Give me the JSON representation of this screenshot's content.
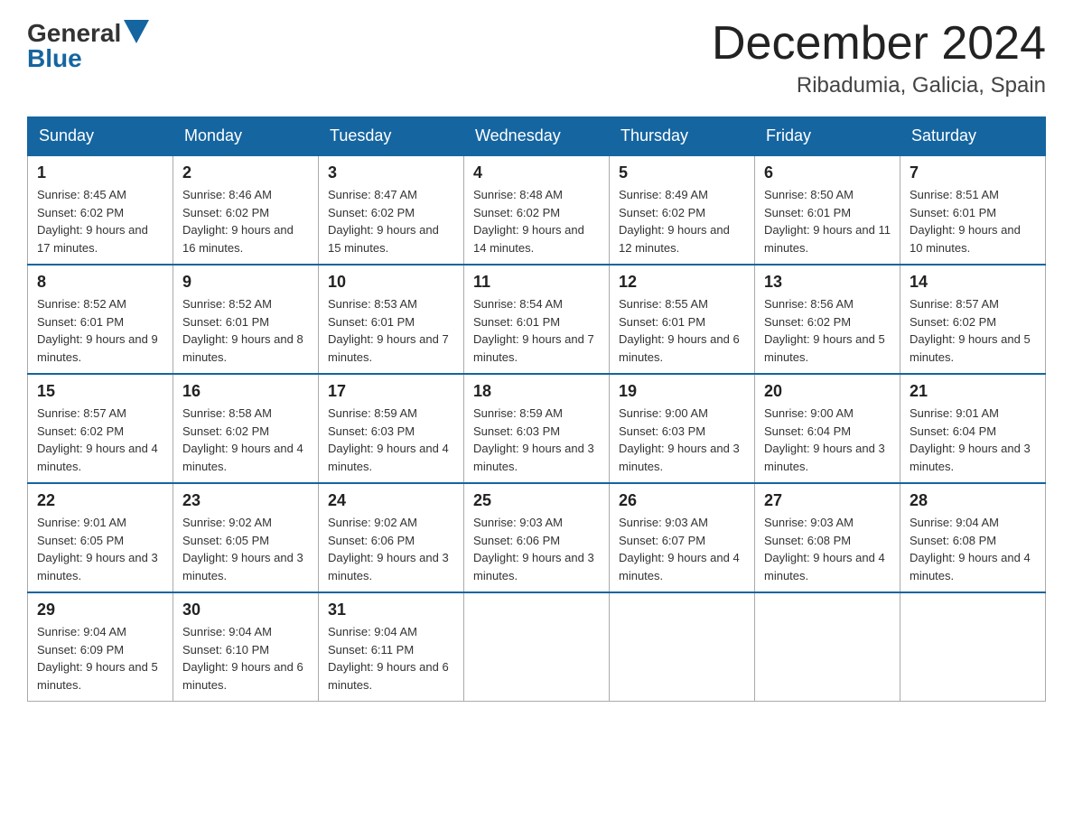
{
  "logo": {
    "text_general": "General",
    "text_blue": "Blue"
  },
  "header": {
    "month_year": "December 2024",
    "location": "Ribadumia, Galicia, Spain"
  },
  "weekdays": [
    "Sunday",
    "Monday",
    "Tuesday",
    "Wednesday",
    "Thursday",
    "Friday",
    "Saturday"
  ],
  "weeks": [
    [
      {
        "day": "1",
        "sunrise": "8:45 AM",
        "sunset": "6:02 PM",
        "daylight": "9 hours and 17 minutes."
      },
      {
        "day": "2",
        "sunrise": "8:46 AM",
        "sunset": "6:02 PM",
        "daylight": "9 hours and 16 minutes."
      },
      {
        "day": "3",
        "sunrise": "8:47 AM",
        "sunset": "6:02 PM",
        "daylight": "9 hours and 15 minutes."
      },
      {
        "day": "4",
        "sunrise": "8:48 AM",
        "sunset": "6:02 PM",
        "daylight": "9 hours and 14 minutes."
      },
      {
        "day": "5",
        "sunrise": "8:49 AM",
        "sunset": "6:02 PM",
        "daylight": "9 hours and 12 minutes."
      },
      {
        "day": "6",
        "sunrise": "8:50 AM",
        "sunset": "6:01 PM",
        "daylight": "9 hours and 11 minutes."
      },
      {
        "day": "7",
        "sunrise": "8:51 AM",
        "sunset": "6:01 PM",
        "daylight": "9 hours and 10 minutes."
      }
    ],
    [
      {
        "day": "8",
        "sunrise": "8:52 AM",
        "sunset": "6:01 PM",
        "daylight": "9 hours and 9 minutes."
      },
      {
        "day": "9",
        "sunrise": "8:52 AM",
        "sunset": "6:01 PM",
        "daylight": "9 hours and 8 minutes."
      },
      {
        "day": "10",
        "sunrise": "8:53 AM",
        "sunset": "6:01 PM",
        "daylight": "9 hours and 7 minutes."
      },
      {
        "day": "11",
        "sunrise": "8:54 AM",
        "sunset": "6:01 PM",
        "daylight": "9 hours and 7 minutes."
      },
      {
        "day": "12",
        "sunrise": "8:55 AM",
        "sunset": "6:01 PM",
        "daylight": "9 hours and 6 minutes."
      },
      {
        "day": "13",
        "sunrise": "8:56 AM",
        "sunset": "6:02 PM",
        "daylight": "9 hours and 5 minutes."
      },
      {
        "day": "14",
        "sunrise": "8:57 AM",
        "sunset": "6:02 PM",
        "daylight": "9 hours and 5 minutes."
      }
    ],
    [
      {
        "day": "15",
        "sunrise": "8:57 AM",
        "sunset": "6:02 PM",
        "daylight": "9 hours and 4 minutes."
      },
      {
        "day": "16",
        "sunrise": "8:58 AM",
        "sunset": "6:02 PM",
        "daylight": "9 hours and 4 minutes."
      },
      {
        "day": "17",
        "sunrise": "8:59 AM",
        "sunset": "6:03 PM",
        "daylight": "9 hours and 4 minutes."
      },
      {
        "day": "18",
        "sunrise": "8:59 AM",
        "sunset": "6:03 PM",
        "daylight": "9 hours and 3 minutes."
      },
      {
        "day": "19",
        "sunrise": "9:00 AM",
        "sunset": "6:03 PM",
        "daylight": "9 hours and 3 minutes."
      },
      {
        "day": "20",
        "sunrise": "9:00 AM",
        "sunset": "6:04 PM",
        "daylight": "9 hours and 3 minutes."
      },
      {
        "day": "21",
        "sunrise": "9:01 AM",
        "sunset": "6:04 PM",
        "daylight": "9 hours and 3 minutes."
      }
    ],
    [
      {
        "day": "22",
        "sunrise": "9:01 AM",
        "sunset": "6:05 PM",
        "daylight": "9 hours and 3 minutes."
      },
      {
        "day": "23",
        "sunrise": "9:02 AM",
        "sunset": "6:05 PM",
        "daylight": "9 hours and 3 minutes."
      },
      {
        "day": "24",
        "sunrise": "9:02 AM",
        "sunset": "6:06 PM",
        "daylight": "9 hours and 3 minutes."
      },
      {
        "day": "25",
        "sunrise": "9:03 AM",
        "sunset": "6:06 PM",
        "daylight": "9 hours and 3 minutes."
      },
      {
        "day": "26",
        "sunrise": "9:03 AM",
        "sunset": "6:07 PM",
        "daylight": "9 hours and 4 minutes."
      },
      {
        "day": "27",
        "sunrise": "9:03 AM",
        "sunset": "6:08 PM",
        "daylight": "9 hours and 4 minutes."
      },
      {
        "day": "28",
        "sunrise": "9:04 AM",
        "sunset": "6:08 PM",
        "daylight": "9 hours and 4 minutes."
      }
    ],
    [
      {
        "day": "29",
        "sunrise": "9:04 AM",
        "sunset": "6:09 PM",
        "daylight": "9 hours and 5 minutes."
      },
      {
        "day": "30",
        "sunrise": "9:04 AM",
        "sunset": "6:10 PM",
        "daylight": "9 hours and 6 minutes."
      },
      {
        "day": "31",
        "sunrise": "9:04 AM",
        "sunset": "6:11 PM",
        "daylight": "9 hours and 6 minutes."
      },
      null,
      null,
      null,
      null
    ]
  ]
}
